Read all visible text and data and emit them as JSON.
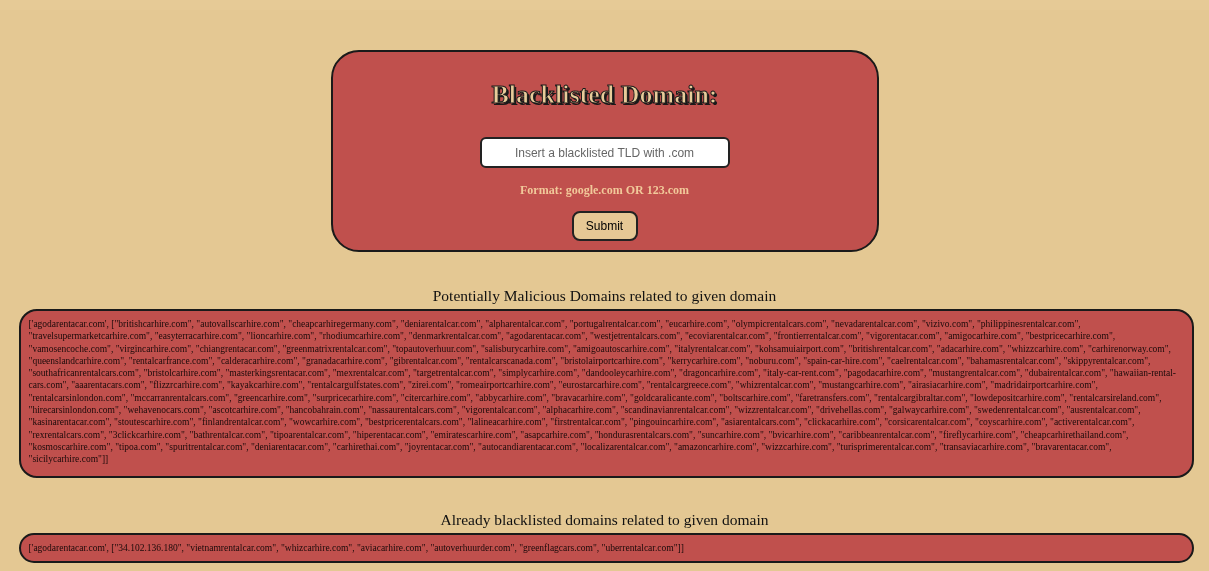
{
  "form": {
    "title": "Blacklisted Domain:",
    "input": {
      "placeholder": "Insert a blacklisted TLD with .com"
    },
    "format_hint": "Format: google.com OR 123.com",
    "submit": "Submit"
  },
  "sections": [
    {
      "heading": "Potentially Malicious Domains related to given domain",
      "result": "['agodarentacar.com', [\"britishcarhire.com\", \"autovallscarhire.com\", \"cheapcarhiregermany.com\", \"deniarentalcar.com\", \"alpharentalcar.com\", \"portugalrentalcar.com\", \"eucarhire.com\", \"olympicrentalcars.com\", \"nevadarentalcar.com\", \"vizivo.com\", \"philippinesrentalcar.com\", \"travelsupermarketcarhire.com\", \"easyterracarhire.com\", \"lioncarhire.com\", \"rhodiumcarhire.com\", \"denmarkrentalcar.com\", \"agodarentacar.com\", \"westjetrentalcars.com\", \"ecoviarentalcar.com\", \"frontierrentalcar.com\", \"vigorentacar.com\", \"amigocarhire.com\", \"bestpricecarhire.com\", \"vamosencoche.com\", \"virgincarhire.com\", \"chiangrentacar.com\", \"greenmatrixrentalcar.com\", \"topautoverhuur.com\", \"salisburycarhire.com\", \"amigoautoscarhire.com\", \"italyrentalcar.com\", \"kohsamuiairport.com\", \"britishrentalcar.com\", \"adacarhire.com\", \"whizzcarhire.com\", \"carhirenorway.com\", \"queenslandcarhire.com\", \"rentalcarfrance.com\", \"calderacarhire.com\", \"granadacarhire.com\", \"gibrentalcar.com\", \"rentalcarscanada.com\", \"bristolairportcarhire.com\", \"kerrycarhire.com\", \"noburu.com\", \"spain-car-hire.com\", \"caelrentalcar.com\", \"bahamasrentalcar.com\", \"skippyrentalcar.com\", \"southafricanrentalcars.com\", \"bristolcarhire.com\", \"masterkingsrentacar.com\", \"mexrentalcar.com\", \"targetrentalcar.com\", \"simplycarhire.com\", \"dandooleycarhire.com\", \"dragoncarhire.com\", \"italy-car-rent.com\", \"pagodacarhire.com\", \"mustangrentalcar.com\", \"dubairentalcar.com\", \"hawaiian-rental-cars.com\", \"aaarentacars.com\", \"flizzrcarhire.com\", \"kayakcarhire.com\", \"rentalcargulfstates.com\", \"zirei.com\", \"romeairportcarhire.com\", \"eurostarcarhire.com\", \"rentalcargreece.com\", \"whizrentalcar.com\", \"mustangcarhire.com\", \"airasiacarhire.com\", \"madridairportcarhire.com\", \"rentalcarsinlondon.com\", \"mccarranrentalcars.com\", \"greencarhire.com\", \"surpricecarhire.com\", \"citercarhire.com\", \"abbycarhire.com\", \"bravacarhire.com\", \"goldcaralicante.com\", \"boltscarhire.com\", \"faretransfers.com\", \"rentalcargibraltar.com\", \"lowdepositcarhire.com\", \"rentalcarsireland.com\", \"hirecarsinlondon.com\", \"wehavenocars.com\", \"ascotcarhire.com\", \"hancobahrain.com\", \"nassaurentalcars.com\", \"vigorentalcar.com\", \"alphacarhire.com\", \"scandinavianrentalcar.com\", \"wizzrentalcar.com\", \"drivehellas.com\", \"galwaycarhire.com\", \"swedenrentalcar.com\", \"ausrentalcar.com\", \"kasinarentacar.com\", \"stoutescarhire.com\", \"finlandrentalcar.com\", \"wowcarhire.com\", \"bestpricerentalcars.com\", \"lalineacarhire.com\", \"firstrentalcar.com\", \"pingouincarhire.com\", \"asiarentalcars.com\", \"clickacarhire.com\", \"corsicarentalcar.com\", \"coyscarhire.com\", \"activerentalcar.com\", \"rexrentalcars.com\", \"3clickcarhire.com\", \"bathrentalcar.com\", \"tipoarentalcar.com\", \"hiperentacar.com\", \"emiratescarhire.com\", \"asapcarhire.com\", \"hondurasrentalcars.com\", \"suncarhire.com\", \"bvicarhire.com\", \"caribbeanrentalcar.com\", \"fireflycarhire.com\", \"cheapcarhirethailand.com\", \"kosmoscarhire.com\", \"tipoa.com\", \"spuritrentalcar.com\", \"deniarentacar.com\", \"carhirethai.com\", \"joyrentacar.com\", \"autocandiarentacar.com\", \"localizarentalcar.com\", \"amazoncarhire.com\", \"wizzcarhire.com\", \"turisprimerentalcar.com\", \"transaviacarhire.com\", \"bravarentacar.com\", \"sicilycarhire.com\"]]"
    },
    {
      "heading": "Already blacklisted domains related to given domain",
      "result": "['agodarentacar.com', [\"34.102.136.180\", \"vietnamrentalcar.com\", \"whizcarhire.com\", \"aviacarhire.com\", \"autoverhuurder.com\", \"greenflagcars.com\", \"uberrentalcar.com\"]]"
    }
  ]
}
